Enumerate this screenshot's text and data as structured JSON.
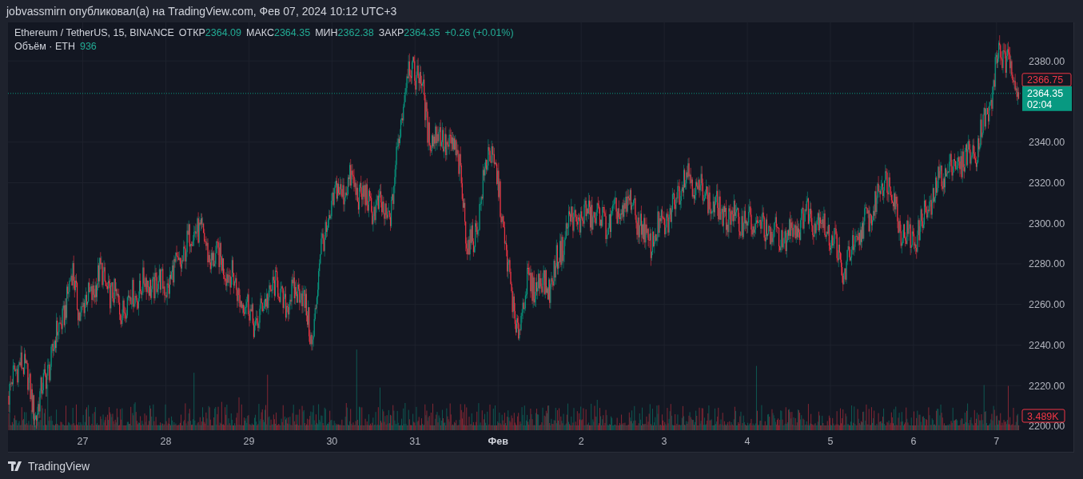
{
  "header": "jobvassmirn опубликовал(а) на TradingView.com, Фев 07, 2024 10:12 UTC+3",
  "legend": {
    "symbol": "Ethereum / TetherUS, 15, BINANCE",
    "fields": [
      {
        "label": "ОТКР",
        "value": "2364.09"
      },
      {
        "label": "МАКС",
        "value": "2364.35"
      },
      {
        "label": "МИН",
        "value": "2362.38"
      },
      {
        "label": "ЗАКР",
        "value": "2364.35"
      }
    ],
    "change": "+0.26 (+0.01%)",
    "volume_label": "Объём · ETH",
    "volume_value": "936"
  },
  "chart": {
    "price_labels": [
      "2380.00",
      "2340.00",
      "2320.00",
      "2300.00",
      "2280.00",
      "2260.00",
      "2240.00",
      "2220.00",
      "2200.00"
    ],
    "date_labels": [
      {
        "text": "27",
        "kind": "day"
      },
      {
        "text": "28",
        "kind": "day"
      },
      {
        "text": "29",
        "kind": "day"
      },
      {
        "text": "30",
        "kind": "day"
      },
      {
        "text": "31",
        "kind": "day"
      },
      {
        "text": "Фев",
        "kind": "month"
      },
      {
        "text": "2",
        "kind": "day"
      },
      {
        "text": "3",
        "kind": "day"
      },
      {
        "text": "4",
        "kind": "day"
      },
      {
        "text": "5",
        "kind": "day"
      },
      {
        "text": "6",
        "kind": "day"
      },
      {
        "text": "7",
        "kind": "day"
      }
    ],
    "price_tags": [
      {
        "kind": "outline",
        "text": "2366.75"
      },
      {
        "kind": "filled",
        "text": "2364.35",
        "sub": "02:04"
      }
    ],
    "volume_tag": "3.489K"
  },
  "footer": {
    "brand": "TradingView"
  }
}
